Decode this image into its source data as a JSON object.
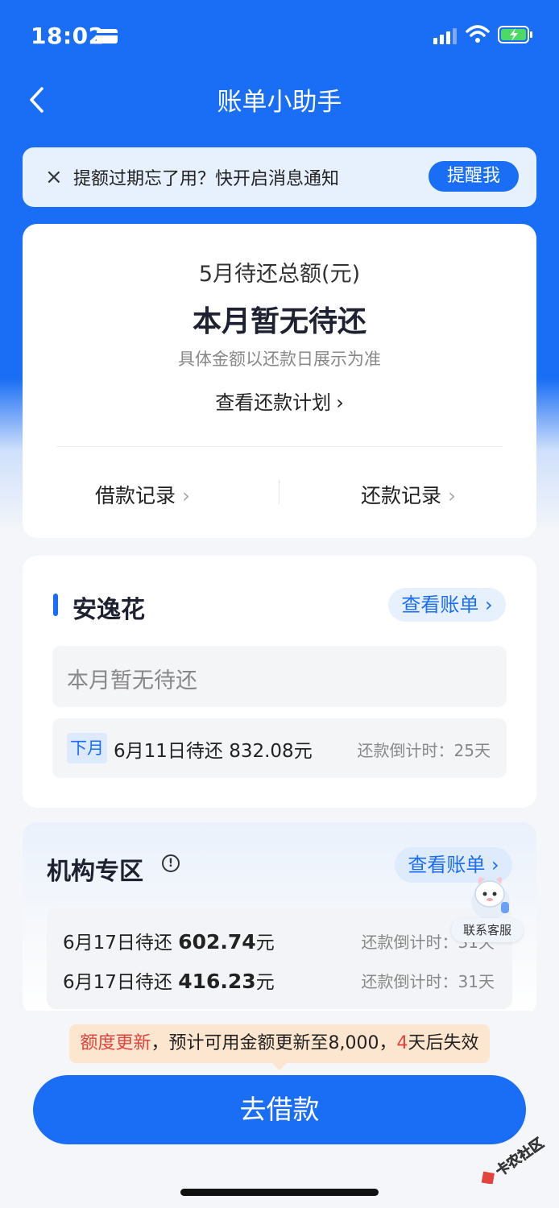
{
  "status_bar": {
    "time": "18:02"
  },
  "header": {
    "title": "账单小助手"
  },
  "notification": {
    "close_glyph": "×",
    "text": "提额过期忘了用？快开启消息通知",
    "button": "提醒我"
  },
  "summary": {
    "label": "5月待还总额(元)",
    "value": "本月暂无待还",
    "note": "具体金额以还款日展示为准",
    "plan_link": "查看还款计划",
    "borrow_records": "借款记录",
    "repay_records": "还款记录"
  },
  "anyihua": {
    "title": "安逸花",
    "view_bill": "查看账单 ›",
    "empty_text": "本月暂无待还",
    "next_tag": "下月",
    "next_text": "6月11日待还 832.08元",
    "countdown": "还款倒计时：25天"
  },
  "institution": {
    "title": "机构专区",
    "info_glyph": "!",
    "view_bill": "查看账单 ›",
    "rows": [
      {
        "date_text": "6月17日待还",
        "amount": "602.74",
        "unit": "元",
        "countdown": "还款倒计时：31天"
      },
      {
        "date_text": "6月17日待还",
        "amount": "416.23",
        "unit": "元",
        "countdown": "还款倒计时：31天"
      }
    ]
  },
  "service": {
    "label": "联系客服"
  },
  "tip": {
    "part1": "额度更新",
    "part2": "，预计可用金额更新至8,000，",
    "part3": "4",
    "part4": "天后失效"
  },
  "bottom": {
    "borrow_button": "去借款"
  },
  "watermark": {
    "text": "卡农社区"
  },
  "colors": {
    "brand_blue": "#1a6ef5",
    "warning_red": "#e2433d",
    "tip_bg": "#fde6cf"
  }
}
